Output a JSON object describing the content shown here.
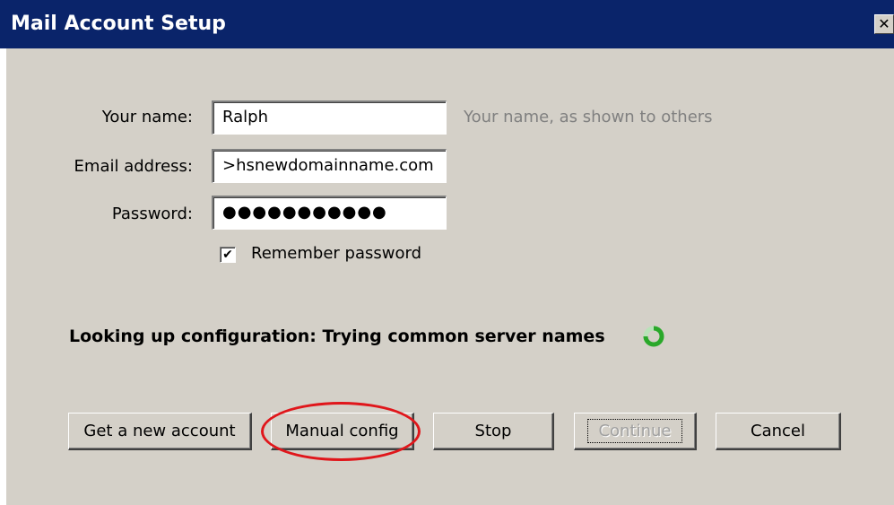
{
  "window": {
    "title": "Mail Account Setup",
    "close_glyph": "✕"
  },
  "form": {
    "name_label": "Your name:",
    "name_value": "Ralph",
    "name_hint": "Your name, as shown to others",
    "email_label": "Email address:",
    "email_value": ">hsnewdomainname.com",
    "password_label": "Password:",
    "password_value": "●●●●●●●●●●●",
    "remember_label": "Remember password",
    "remember_checked": true,
    "remember_check_glyph": "✔"
  },
  "status": {
    "text": "Looking up configuration: Trying common server names",
    "spinner_color": "#2aa82a"
  },
  "buttons": {
    "new_account": "Get a new account",
    "manual_config": "Manual config",
    "stop": "Stop",
    "continue": "Continue",
    "cancel": "Cancel"
  },
  "colors": {
    "titlebar": "#0a246a",
    "dialog_bg": "#d4d0c8",
    "highlight_circle": "#e0161b"
  }
}
